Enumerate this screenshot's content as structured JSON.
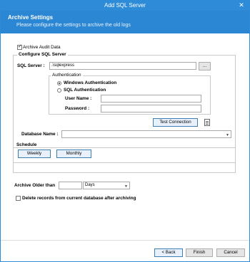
{
  "window": {
    "title": "Add SQL Server",
    "close_glyph": "✕"
  },
  "banner": {
    "title": "Archive Settings",
    "subtitle": "Please configure the settings to archive the old logs"
  },
  "archive_audit": {
    "label": "Archive Audit Data",
    "checked": true
  },
  "configure": {
    "legend": "Configure SQL Server",
    "server_label": "SQL Server :",
    "server_value": ".\\sqlexpress",
    "browse_label": "...",
    "auth": {
      "legend": "Authentication",
      "windows_label": "Windows Authentication",
      "sql_label": "SQL Authentication",
      "selected": "windows",
      "username_label": "User Name :",
      "username_value": "",
      "password_label": "Password  :",
      "password_value": ""
    },
    "test_button": "Test Connection",
    "database_label": "Database Name :",
    "database_value": ""
  },
  "schedule": {
    "legend": "Schedule",
    "weekly": "Weekly",
    "monthly": "Monthly"
  },
  "archive_older": {
    "label": "Archive Older than",
    "value": "",
    "unit": "Days"
  },
  "delete_records": {
    "label": "Delete records from current database after archiving",
    "checked": false
  },
  "footer": {
    "back": "< Back",
    "finish": "Finish",
    "cancel": "Cancel"
  }
}
